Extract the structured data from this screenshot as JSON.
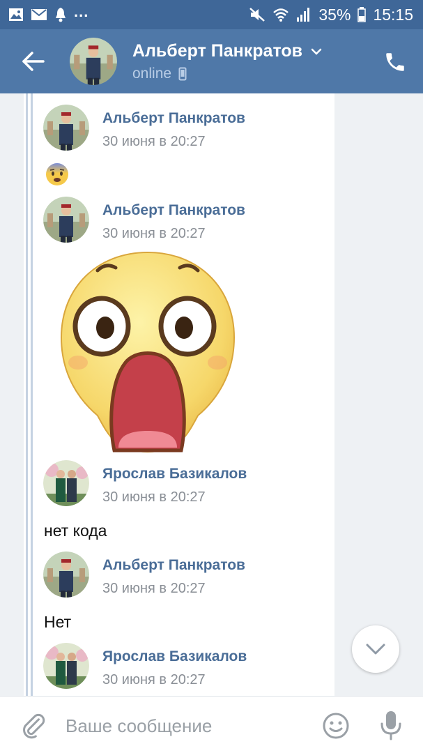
{
  "status_bar": {
    "battery": "35%",
    "time": "15:15",
    "icons_left": [
      "image-notification-icon",
      "mail-notification-icon",
      "bell-notification-icon",
      "more-notifications-icon"
    ],
    "icons_right": [
      "mute-icon",
      "wifi-icon",
      "signal-icon",
      "battery-icon"
    ]
  },
  "header": {
    "name": "Альберт Панкратов",
    "status": "online",
    "icons": [
      "back-arrow-icon",
      "chevron-down-icon",
      "mobile-device-icon",
      "phone-icon"
    ]
  },
  "messages": [
    {
      "author": "Альберт Панкратов",
      "time": "30 июня в 20:27",
      "content_type": "emoji",
      "content": "anxious-face-emoji"
    },
    {
      "author": "Альберт Панкратов",
      "time": "30 июня в 20:27",
      "content_type": "sticker",
      "content": "shocked-face-sticker"
    },
    {
      "author": "Ярослав Базикалов",
      "time": "30 июня в 20:27",
      "content_type": "text",
      "content": "нет кода"
    },
    {
      "author": "Альберт Панкратов",
      "time": "30 июня в 20:27",
      "content_type": "text",
      "content": "Нет"
    },
    {
      "author": "Ярослав Базикалов",
      "time": "30 июня в 20:27",
      "content_type": "text",
      "content": ""
    }
  ],
  "composer": {
    "placeholder": "Ваше сообщение",
    "icons": [
      "paperclip-icon",
      "smiley-icon",
      "microphone-icon"
    ]
  },
  "colors": {
    "status_bar": "#3f6798",
    "header": "#4f78a8",
    "name_link": "#4a6d97",
    "timestamp": "#8a8f96",
    "chat_bg": "#eef1f4",
    "forward_line": "#c5d2e2"
  }
}
